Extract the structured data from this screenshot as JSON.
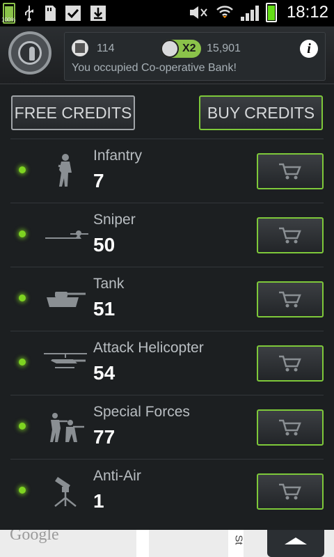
{
  "status_bar": {
    "battery_label": "100%",
    "time": "18:12"
  },
  "header": {
    "land_count": "114",
    "multiplier": "X2",
    "coin_balance": "15,901",
    "message": "You occupied Co-operative Bank!",
    "info_glyph": "i"
  },
  "actions": {
    "free_credits": "FREE CREDITS",
    "buy_credits": "BUY CREDITS"
  },
  "units": [
    {
      "name": "Infantry",
      "count": "7",
      "icon": "infantry-icon"
    },
    {
      "name": "Sniper",
      "count": "50",
      "icon": "sniper-icon"
    },
    {
      "name": "Tank",
      "count": "51",
      "icon": "tank-icon"
    },
    {
      "name": "Attack Helicopter",
      "count": "54",
      "icon": "helicopter-icon"
    },
    {
      "name": "Special Forces",
      "count": "77",
      "icon": "special-forces-icon"
    },
    {
      "name": "Anti-Air",
      "count": "1",
      "icon": "anti-air-icon"
    }
  ],
  "map": {
    "attribution": "Google",
    "street_label": "St"
  },
  "colors": {
    "accent_green": "#7ec93a",
    "led_green": "#7ed321",
    "background": "#1c1f21"
  }
}
